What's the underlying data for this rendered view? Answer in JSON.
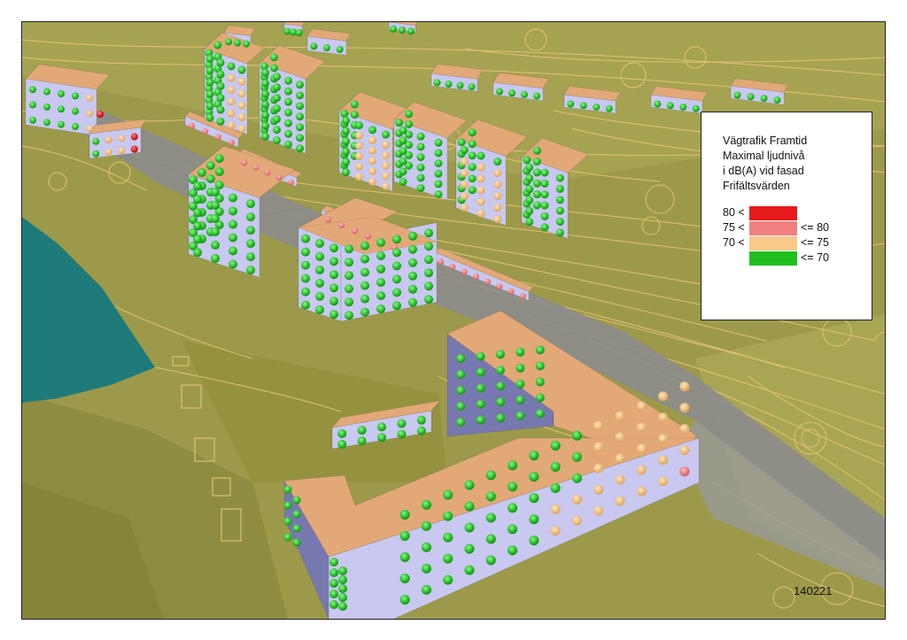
{
  "legend": {
    "title_lines": [
      "Vägtrafik Framtid",
      "Maximal ljudnivå",
      "i dB(A) vid fasad",
      "Frifältsvärden"
    ],
    "classes": [
      {
        "lower": "80 <",
        "upper": "",
        "color": "#e8191c"
      },
      {
        "lower": "75 <",
        "upper": "<= 80",
        "color": "#f08080"
      },
      {
        "lower": "70 <",
        "upper": "<= 75",
        "color": "#f9c98a"
      },
      {
        "lower": "",
        "upper": "<= 70",
        "color": "#1fbf1f"
      }
    ]
  },
  "stamp": "140221",
  "colors": {
    "terrain": "#9c9a4a",
    "contour": "#f0c878",
    "water": "#1f7a7a",
    "road": "#8c8c8c",
    "roof": "#e2a878",
    "facade_light": "#c8c8f0",
    "facade_dark": "#7878b0"
  }
}
